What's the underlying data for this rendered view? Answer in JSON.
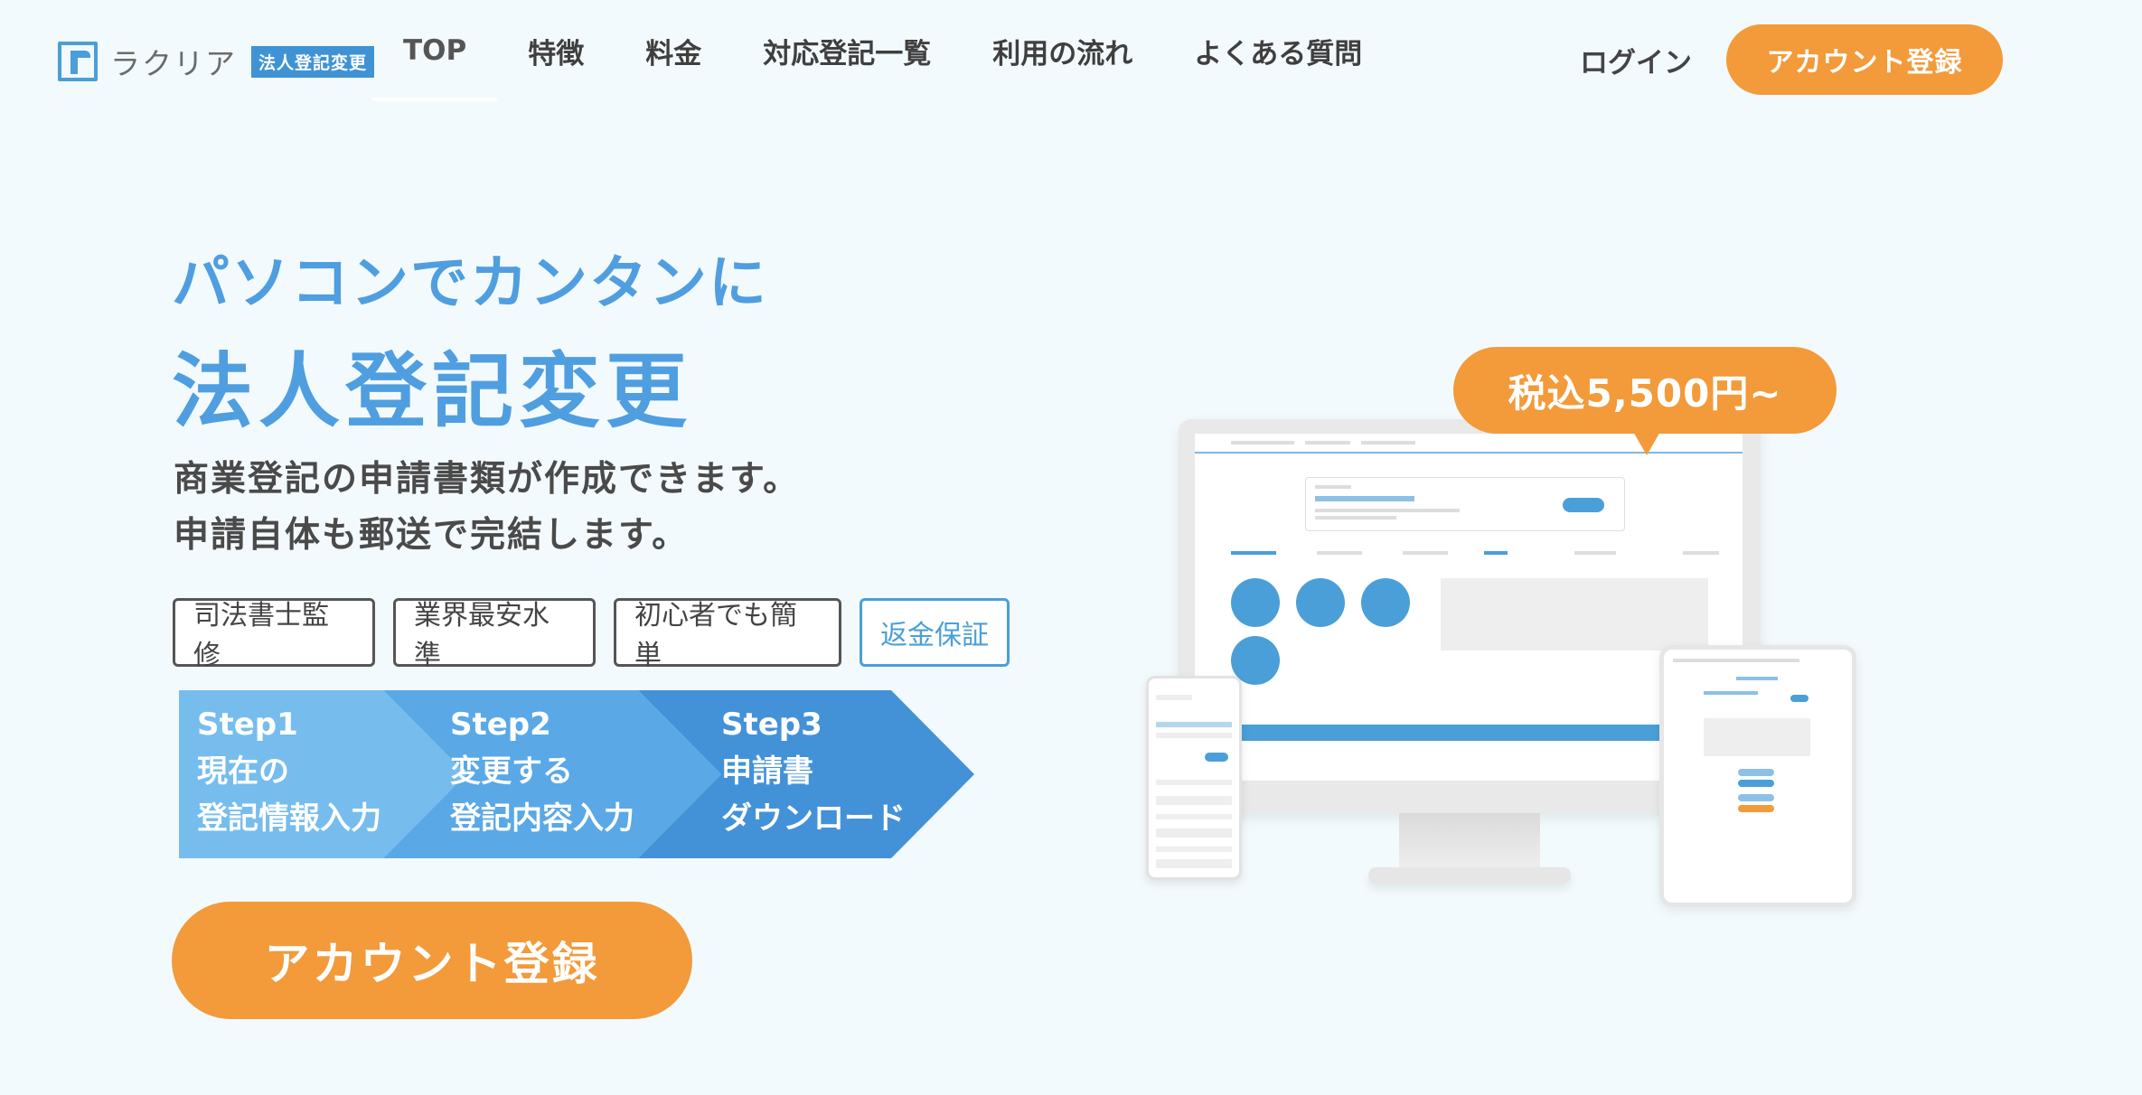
{
  "header": {
    "logo_text": "ラクリア",
    "logo_badge": "法人登記変更",
    "nav": [
      {
        "label": "TOP"
      },
      {
        "label": "特徴"
      },
      {
        "label": "料金"
      },
      {
        "label": "対応登記一覧"
      },
      {
        "label": "利用の流れ"
      },
      {
        "label": "よくある質問"
      }
    ],
    "login_label": "ログイン",
    "cta_label": "アカウント登録"
  },
  "hero": {
    "subtitle": "パソコンでカンタンに",
    "title": "法人登記変更",
    "desc_line1": "商業登記の申請書類が作成できます。",
    "desc_line2": "申請自体も郵送で完結します。",
    "tags": [
      "司法書士監修",
      "業界最安水準",
      "初心者でも簡単",
      "返金保証"
    ],
    "steps": [
      {
        "step": "Step1",
        "line1": "現在の",
        "line2": "登記情報入力"
      },
      {
        "step": "Step2",
        "line1": "変更する",
        "line2": "登記内容入力"
      },
      {
        "step": "Step3",
        "line1": "申請書",
        "line2": "ダウンロード"
      }
    ],
    "cta_label": "アカウント登録",
    "price_label": "税込5,500円~"
  },
  "colors": {
    "brand_blue": "#4f9ee0",
    "accent_orange": "#f39a3a",
    "background": "#f3fafd"
  }
}
